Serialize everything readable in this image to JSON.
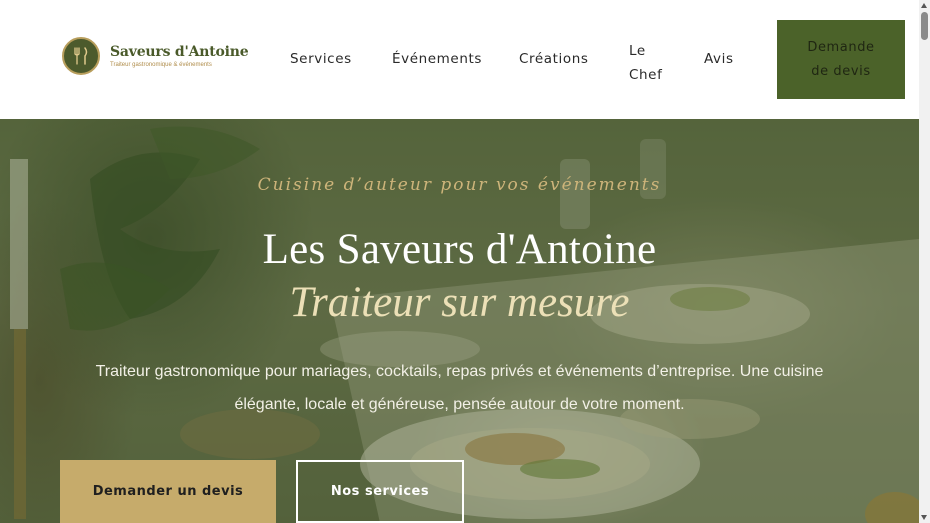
{
  "brand": {
    "name": "Saveurs d'Antoine",
    "tagline": "Traiteur gastronomique & événements",
    "logo_icon": "fork-knife-icon"
  },
  "nav": {
    "services": "Services",
    "events": "Événements",
    "creations": "Créations",
    "chef": "Le Chef",
    "reviews": "Avis",
    "cta": "Demande de devis"
  },
  "hero": {
    "eyebrow": "Cuisine d’auteur pour vos événements",
    "title": "Les Saveurs d'Antoine",
    "subtitle": "Traiteur sur mesure",
    "description": "Traiteur gastronomique pour mariages, cocktails, repas privés et événements d’entreprise. Une cuisine élégante, locale et généreuse, pensée autour de votre moment.",
    "primary_button": "Demander un devis",
    "secondary_button": "Nos services"
  },
  "colors": {
    "brand_green": "#4b6229",
    "gold": "#c6ab6b",
    "eyebrow_gold": "#cdb47a"
  }
}
